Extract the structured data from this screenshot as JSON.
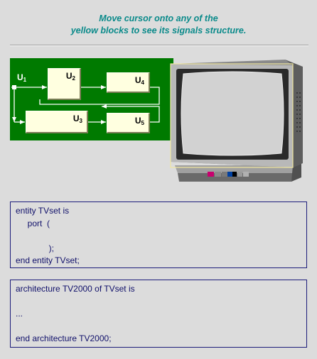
{
  "instruction": {
    "line1": "Move cursor onto any of the",
    "line2": "yellow blocks to see its signals structure."
  },
  "diagram": {
    "input_label": "U",
    "input_sub": "1",
    "blocks": [
      {
        "label": "U",
        "sub": "2"
      },
      {
        "label": "U",
        "sub": "4"
      },
      {
        "label": "U",
        "sub": "3"
      },
      {
        "label": "U",
        "sub": "5"
      }
    ]
  },
  "entity_code": [
    "entity TVset is",
    "     port  (",
    "",
    "              );",
    "end entity TVset;"
  ],
  "architecture_code": [
    "architecture TV2000 of TVset is",
    "",
    "...",
    "",
    "end architecture TV2000;"
  ],
  "colors": {
    "title": "#0a8a8a",
    "diagram_bg": "#007a00",
    "block": "#ffffe0",
    "code_text": "#10106a"
  }
}
